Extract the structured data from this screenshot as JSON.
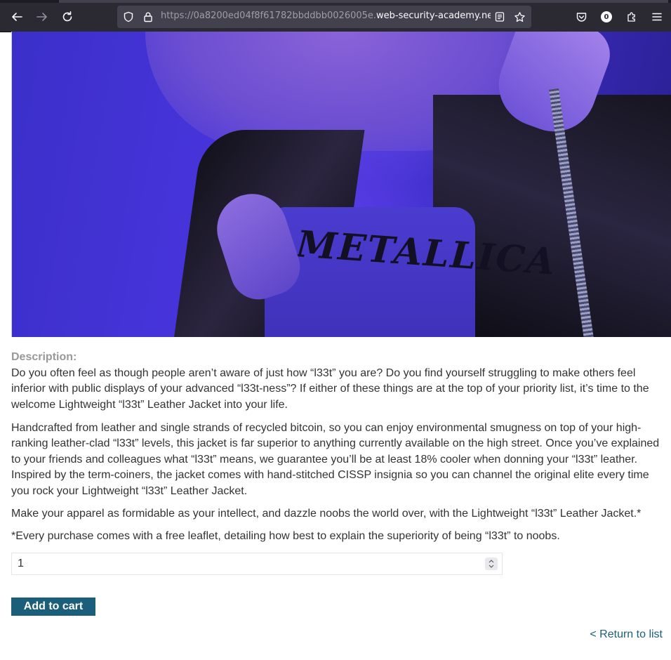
{
  "browser": {
    "url_prefix": "https://0a8200ed04f8f61782bbddbb0026005e.",
    "url_domain": "web-security-academy.net",
    "url_suffix": "/",
    "extensions_badge": "0"
  },
  "product": {
    "image_print": "METALLICA",
    "description_label": "Description:",
    "paragraphs": [
      "Do you often feel as though people aren’t aware of just how “l33t” you are? Do you find yourself struggling to make others feel inferior with public displays of your advanced “l33t-ness”? If either of these things are at the top of your priority list, it’s time to the welcome Lightweight “l33t” Leather Jacket into your life.",
      "Handcrafted from leather and single strands of recycled bitcoin, so you can enjoy environmental smugness on top of your high-ranking leather-clad “l33t” levels, this jacket is far superior to anything currently available on the high street. Once you’ve explained to your friends and colleagues what “l33t” means, we guarantee you’ll be at least 18% cooler when donning your “l33t” leather. Inspired by the term-coiners, the jacket comes with hand-stitched CISSP insignia so you can channel the original elite every time you rock your Lightweight “l33t” Leather Jacket.",
      "Make your apparel as formidable as your intellect, and dazzle noobs the world over, with the Lightweight “l33t” Leather Jacket.*",
      "*Every purchase comes with a free leaflet, detailing how best to explain the superiority of being “l33t” to noobs."
    ],
    "quantity": "1",
    "add_to_cart_label": "Add to cart",
    "return_label": "< Return to list"
  },
  "colors": {
    "toolbar_bg": "#2b2a33",
    "urlbar_bg": "#42414d",
    "button_bg": "#1a5e7a",
    "label_grey": "#999999",
    "text": "#333333"
  }
}
